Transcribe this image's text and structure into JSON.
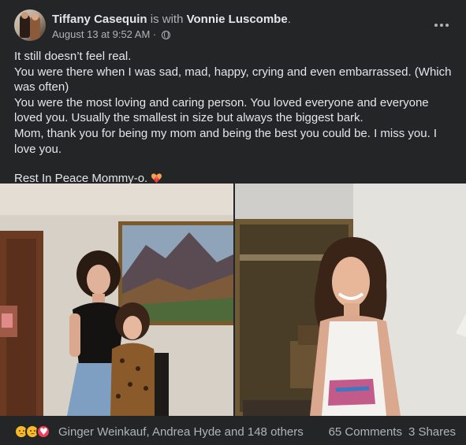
{
  "post": {
    "author": "Tiffany Casequin",
    "with_text": " is with ",
    "tagged": "Vonnie Luscombe",
    "period": ".",
    "timestamp": "August 13 at 9:52 AM",
    "separator": " · ",
    "privacy_icon": "globe-icon",
    "more_icon": "more-options-icon"
  },
  "body": {
    "lines": [
      "It still doesn’t feel real.",
      "You were there when I was sad, mad, happy, crying and even embarrassed. (Which was often)",
      "You were the most loving and caring person. You loved everyone and everyone loved you. Usually the smallest in size but always the biggest bark.",
      "Mom, thank you for being my mom and being the best you could be. I miss you. I love you."
    ],
    "closing": "Rest In Peace Mommy-o.",
    "closing_emoji": "heart-with-ribbon-icon"
  },
  "photos": [
    {
      "icon": "photo-mother-and-daughter"
    },
    {
      "icon": "photo-woman-smiling"
    }
  ],
  "footer": {
    "reaction_icons": [
      "care-reaction-icon",
      "sad-reaction-icon",
      "love-reaction-icon"
    ],
    "reactors": "Ginger Weinkauf, Andrea Hyde and 148 others",
    "comments": "65 Comments",
    "shares": "3 Shares"
  },
  "colors": {
    "background": "#242526",
    "text_primary": "#e4e6eb",
    "text_secondary": "#b0b3b8",
    "love": "#f33e58",
    "care": "#f7b928"
  }
}
